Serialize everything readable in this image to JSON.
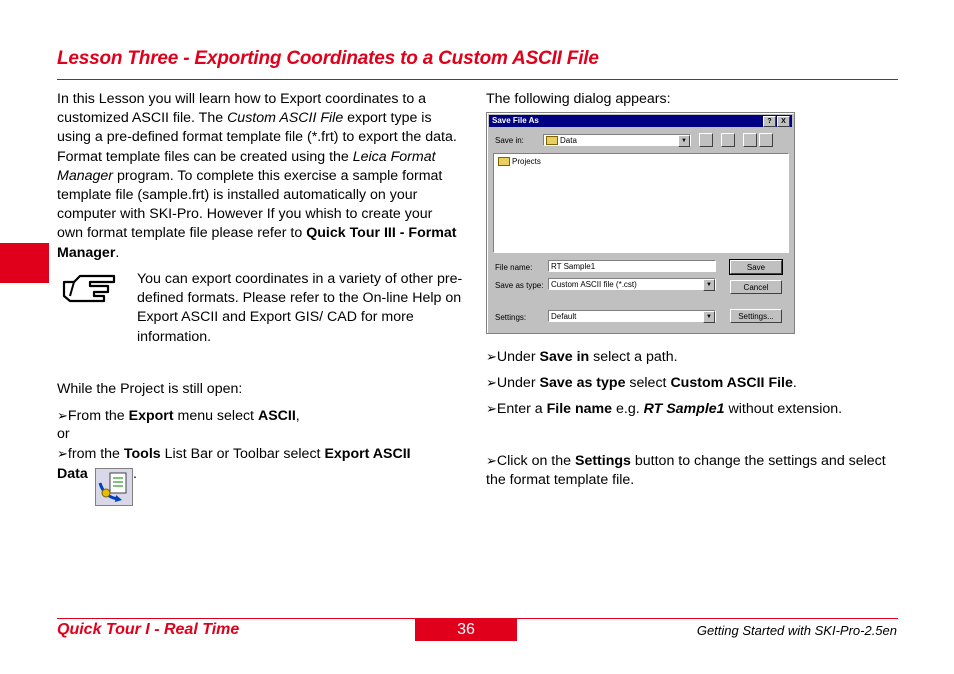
{
  "title": "Lesson Three - Exporting Coordinates to a Custom ASCII File",
  "left": {
    "intro_1": "In this Lesson you will learn how to Export coordinates to a customized ASCII file. The ",
    "intro_em1": "Custom ASCII File",
    "intro_2": " export type is using a pre-defined format template file (*.frt) to export the data. Format template files can be created using the ",
    "intro_em2": "Leica Format Manager",
    "intro_3": " program. To complete this exercise a sample format template file (sample.frt) is installed automatically on your computer with SKI-Pro. However If you whish to create your own format template file please refer to ",
    "intro_bold": "Quick Tour III - Format Manager",
    "intro_end": ".",
    "note": "You can export coordinates in a variety of other pre-defined formats. Please refer to the On-line Help on Export ASCII and Export GIS/ CAD for more information.",
    "while_open": "While the Project is still open:",
    "step1_a": "From the ",
    "step1_b": "Export",
    "step1_c": " menu select ",
    "step1_d": "ASCII",
    "step1_e": ",",
    "or": "or",
    "step2_a": "from the ",
    "step2_b": "Tools",
    "step2_c": " List Bar or Toolbar select ",
    "step2_d": "Export ASCII",
    "step2_e": "Data",
    "step2_f": "."
  },
  "right": {
    "dialog_appears": "The following dialog appears:",
    "s1_a": "Under ",
    "s1_b": "Save in",
    "s1_c": " select a path.",
    "s2_a": "Under ",
    "s2_b": "Save as type",
    "s2_c": " select ",
    "s2_d": "Custom ASCII File",
    "s2_e": ".",
    "s3_a": "Enter a ",
    "s3_b": "File name",
    "s3_c": " e.g. ",
    "s3_d": "RT Sample1",
    "s3_e": " without extension.",
    "s4_a": "Click on the ",
    "s4_b": "Settings",
    "s4_c": " button to change the settings and select the format template file."
  },
  "dialog": {
    "title": "Save File As",
    "help_btn": "?",
    "close_btn": "X",
    "save_in_label": "Save in:",
    "save_in_value": "Data",
    "list_item": "Projects",
    "file_name_label": "File name:",
    "file_name_value": "RT Sample1",
    "save_type_label": "Save as type:",
    "save_type_value": "Custom ASCII file (*.cst)",
    "settings_label": "Settings:",
    "settings_value": "Default",
    "save_btn": "Save",
    "cancel_btn": "Cancel",
    "settings_btn": "Settings..."
  },
  "footer": {
    "left": "Quick Tour I - Real Time",
    "page": "36",
    "right": "Getting Started with SKI-Pro-2.5en"
  },
  "colors": {
    "accent": "#e0001b",
    "dialog_title_bg": "#000080"
  },
  "icons": [
    "pointing-hand-icon",
    "export-ascii-icon",
    "folder-icon",
    "arrow-bullet-icon"
  ]
}
